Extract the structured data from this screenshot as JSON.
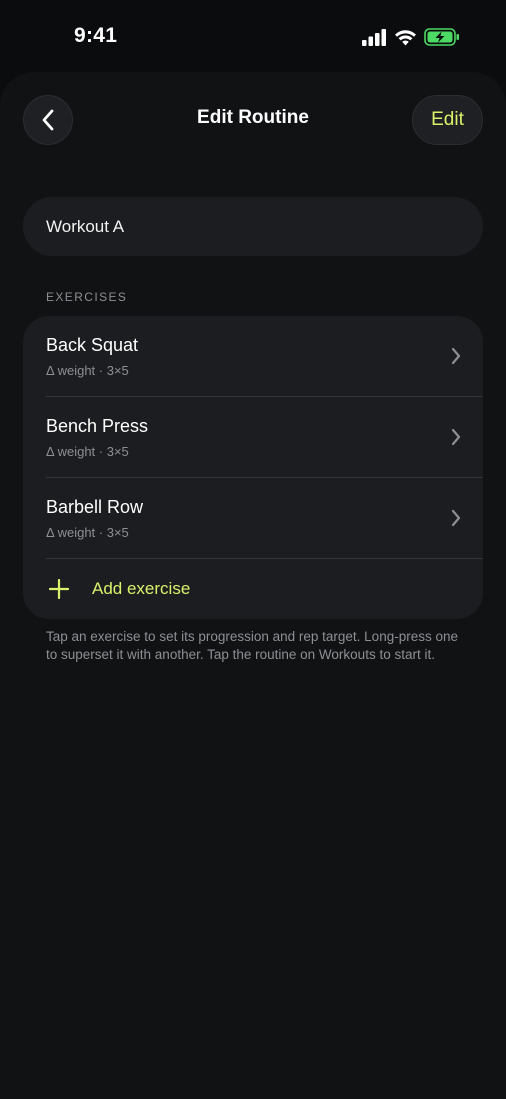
{
  "status_bar": {
    "time": "9:41"
  },
  "header": {
    "title": "Edit Routine",
    "edit_label": "Edit"
  },
  "routine": {
    "name": "Workout A"
  },
  "exercises_section": {
    "label": "EXERCISES",
    "items": [
      {
        "name": "Back Squat",
        "detail": "Δ weight · 3×5"
      },
      {
        "name": "Bench Press",
        "detail": "Δ weight · 3×5"
      },
      {
        "name": "Barbell Row",
        "detail": "Δ weight · 3×5"
      }
    ],
    "add_label": "Add exercise"
  },
  "help_text": "Tap an exercise to set its progression and rep target. Long-press one to superset it with another. Tap the routine on Workouts to start it.",
  "colors": {
    "accent": "#d9f26b",
    "background": "#0b0c0d",
    "surface": "#1c1d20",
    "battery": "#4cd964"
  }
}
